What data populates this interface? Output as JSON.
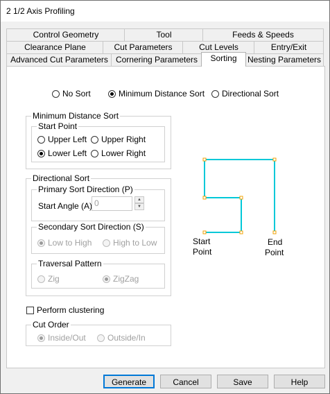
{
  "window": {
    "title": "2 1/2 Axis Profiling"
  },
  "tabs": {
    "row1": [
      "Control Geometry",
      "Tool",
      "Feeds & Speeds"
    ],
    "row2": [
      "Clearance Plane",
      "Cut Parameters",
      "Cut Levels",
      "Entry/Exit"
    ],
    "row3": [
      "Advanced Cut Parameters",
      "Cornering Parameters",
      "Sorting",
      "Nesting Parameters"
    ]
  },
  "sort_mode": {
    "options": [
      "No Sort",
      "Minimum Distance Sort",
      "Directional Sort"
    ],
    "selected": "Minimum Distance Sort"
  },
  "min_distance_sort": {
    "legend": "Minimum Distance Sort",
    "start_point": {
      "legend": "Start Point",
      "options": [
        "Upper Left",
        "Upper Right",
        "Lower Left",
        "Lower Right"
      ],
      "selected": "Lower Left"
    }
  },
  "directional_sort": {
    "legend": "Directional Sort",
    "primary": {
      "legend": "Primary Sort Direction (P)",
      "angle_label": "Start Angle (A)",
      "angle_value": "0"
    },
    "secondary": {
      "legend": "Secondary Sort Direction (S)",
      "options": [
        "Low to High",
        "High to Low"
      ],
      "selected": "Low to High"
    },
    "traversal": {
      "legend": "Traversal Pattern",
      "options": [
        "Zig",
        "ZigZag"
      ],
      "selected": "ZigZag"
    }
  },
  "clustering": {
    "label": "Perform clustering",
    "checked": false
  },
  "cut_order": {
    "legend": "Cut Order",
    "options": [
      "Inside/Out",
      "Outside/In"
    ],
    "selected": "Inside/Out"
  },
  "diagram": {
    "start_line1": "Start",
    "start_line2": "Point",
    "end_line1": "End",
    "end_line2": "Point",
    "path_color": "#00c8d8",
    "point_color": "#f0a000"
  },
  "buttons": {
    "generate": "Generate",
    "cancel": "Cancel",
    "save": "Save",
    "help": "Help"
  }
}
